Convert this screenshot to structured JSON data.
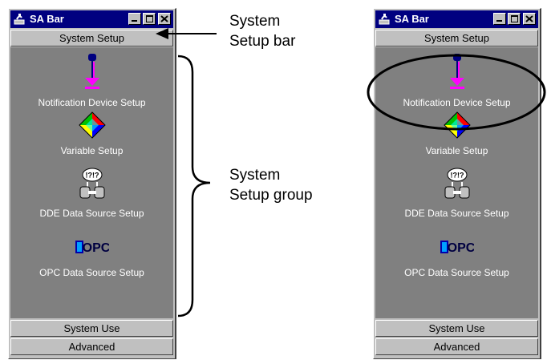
{
  "windows": [
    {
      "id": "left",
      "title": "SA Bar",
      "system_setup_label": "System Setup",
      "items": [
        {
          "label": "Notification Device Setup",
          "icon": "notification-device-icon"
        },
        {
          "label": "Variable Setup",
          "icon": "variable-diamond-icon"
        },
        {
          "label": "DDE Data Source Setup",
          "icon": "dde-source-icon"
        },
        {
          "label": "OPC Data Source Setup",
          "icon": "opc-logo-icon"
        }
      ],
      "system_use_label": "System Use",
      "advanced_label": "Advanced"
    },
    {
      "id": "right",
      "title": "SA Bar",
      "system_setup_label": "System Setup",
      "items": [
        {
          "label": "Notification Device Setup",
          "icon": "notification-device-icon"
        },
        {
          "label": "Variable Setup",
          "icon": "variable-diamond-icon"
        },
        {
          "label": "DDE Data Source Setup",
          "icon": "dde-source-icon"
        },
        {
          "label": "OPC Data Source Setup",
          "icon": "opc-logo-icon"
        }
      ],
      "system_use_label": "System Use",
      "advanced_label": "Advanced"
    }
  ],
  "annotations": {
    "setup_bar_line1": "System",
    "setup_bar_line2": "Setup bar",
    "setup_group_line1": "System",
    "setup_group_line2": "Setup group"
  },
  "icons": {
    "dde_bubble_text": "!?!?",
    "opc_text": "OPC"
  },
  "colors": {
    "titlebar": "#000080",
    "panel": "#c0c0c0",
    "group_bg": "#808080",
    "magenta_arrow": "#ff00ff",
    "navy_dot": "#000080"
  }
}
